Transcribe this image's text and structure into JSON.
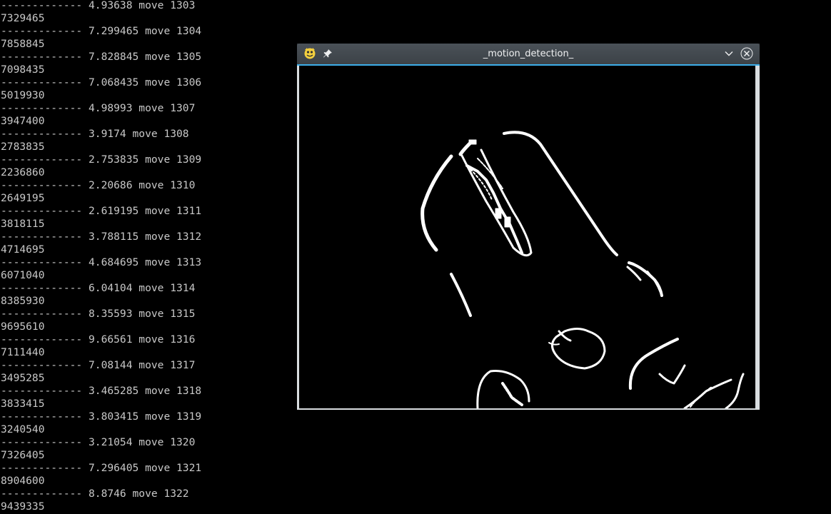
{
  "terminal": {
    "lines": [
      "------------- 4.93638 move 1303",
      "7329465",
      "------------- 7.299465 move 1304",
      "7858845",
      "------------- 7.828845 move 1305",
      "7098435",
      "------------- 7.068435 move 1306",
      "5019930",
      "------------- 4.98993 move 1307",
      "3947400",
      "------------- 3.9174 move 1308",
      "2783835",
      "------------- 2.753835 move 1309",
      "2236860",
      "------------- 2.20686 move 1310",
      "2649195",
      "------------- 2.619195 move 1311",
      "3818115",
      "------------- 3.788115 move 1312",
      "4714695",
      "------------- 4.684695 move 1313",
      "6071040",
      "------------- 6.04104 move 1314",
      "8385930",
      "------------- 8.35593 move 1315",
      "9695610",
      "------------- 9.66561 move 1316",
      "7111440",
      "------------- 7.08144 move 1317",
      "3495285",
      "------------- 3.465285 move 1318",
      "3833415",
      "------------- 3.803415 move 1319",
      "3240540",
      "------------- 3.21054 move 1320",
      "7326405",
      "------------- 7.296405 move 1321",
      "8904600",
      "------------- 8.8746 move 1322",
      "9439335"
    ]
  },
  "window": {
    "title": "_motion_detection_",
    "app_icon": "python-icon",
    "pin_icon": "pin-icon",
    "minimize_icon": "chevron-down-icon",
    "close_icon": "close-icon"
  },
  "colors": {
    "terminal_text": "#c8c8c8",
    "background": "#000000",
    "titlebar": "#3f454b",
    "accent": "#3daee9",
    "frame": "#d9dde0"
  }
}
